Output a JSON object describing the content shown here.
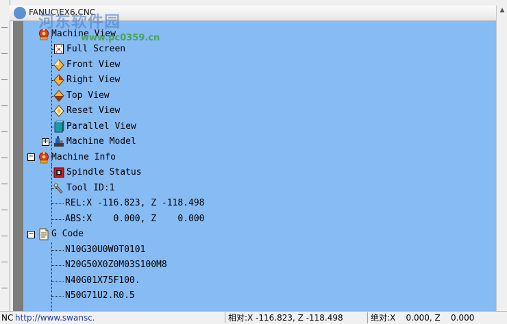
{
  "window": {
    "title": "FANUC\\EX6.CNC",
    "watermark": "河东软件园",
    "watermark_url": "www.pc0359.cn"
  },
  "tree": {
    "machine_view": {
      "label": "Machine View",
      "children": {
        "full_screen": "Full Screen",
        "front_view": "Front View",
        "right_view": "Right View",
        "top_view": "Top View",
        "reset_view": "Reset View",
        "parallel_view": "Parallel View",
        "machine_model": "Machine Model"
      }
    },
    "machine_info": {
      "label": "Machine Info",
      "spindle_status": "Spindle Status",
      "tool_id": "Tool ID:1",
      "rel": "REL:X -116.823, Z -118.498",
      "abs": "ABS:X    0.000, Z    0.000"
    },
    "g_code": {
      "label": "G Code",
      "lines": [
        "N10G30U0W0T0101",
        "N20G50X0Z0M03S100M8",
        "N40G01X75F100.",
        "N50G71U2.R0.5"
      ]
    }
  },
  "statusbar": {
    "app_text": "NC",
    "url": "http://www.swansc.",
    "relative": "相对:X -116.823, Z -118.498",
    "absolute": "绝对:X    0.000, Z    0.000"
  },
  "colors": {
    "tree_background": "#87bbf4",
    "gutter": "#7c7c7c"
  }
}
